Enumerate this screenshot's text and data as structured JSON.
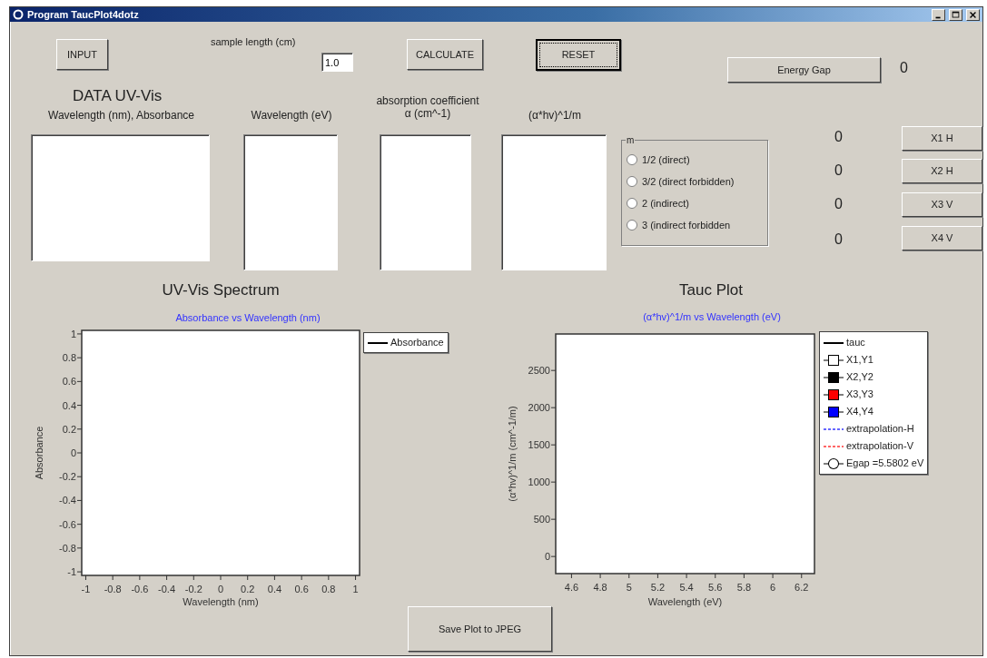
{
  "window": {
    "title": "Program TaucPlot4dotz"
  },
  "buttons": [
    {
      "label": "INPUT",
      "focused": false
    },
    {
      "label": "CALCULATE",
      "focused": false
    },
    {
      "label": "RESET",
      "focused": true
    }
  ],
  "sample_length": {
    "label": "sample length (cm)",
    "value": "1.0"
  },
  "energy_gap": {
    "button": "Energy Gap",
    "value": "0"
  },
  "data_section": {
    "title": "DATA UV-Vis",
    "columns": [
      {
        "header": "Wavelength (nm), Absorbance"
      },
      {
        "header": "Wavelength (eV)"
      },
      {
        "header": "absorption coefficient\nα (cm^-1)"
      },
      {
        "header": "(α*hv)^1/m"
      }
    ]
  },
  "m_group": {
    "label": "m",
    "options": [
      {
        "label": "1/2 (direct)",
        "selected": false
      },
      {
        "label": "3/2 (direct forbidden)",
        "selected": false
      },
      {
        "label": "2 (indirect)",
        "selected": false
      },
      {
        "label": "3 (indirect forbidden",
        "selected": false
      }
    ]
  },
  "points": [
    {
      "value": "0",
      "button": "X1 H"
    },
    {
      "value": "0",
      "button": "X2 H"
    },
    {
      "value": "0",
      "button": "X3 V"
    },
    {
      "value": "0",
      "button": "X4 V"
    }
  ],
  "charts": [
    {
      "heading": "UV-Vis Spectrum",
      "legend": [
        {
          "label": "Absorbance",
          "color": "#000000",
          "kind": "line"
        }
      ],
      "chart_data": {
        "type": "line",
        "title": "Absorbance vs Wavelength (nm)",
        "xlabel": "Wavelength (nm)",
        "ylabel": "Absorbance",
        "xlim": [
          -1.03,
          1.03
        ],
        "ylim": [
          -1.03,
          1.03
        ],
        "xticks": [
          -1,
          -0.8,
          -0.6,
          -0.4,
          -0.2,
          0,
          0.2,
          0.4,
          0.6,
          0.8,
          1
        ],
        "yticks": [
          -1,
          -0.8,
          -0.6,
          -0.4,
          -0.2,
          0,
          0.2,
          0.4,
          0.6,
          0.8,
          1
        ]
      }
    },
    {
      "heading": "Tauc Plot",
      "legend": [
        {
          "label": "tauc",
          "color": "#000000",
          "kind": "line"
        },
        {
          "label": "X1,Y1",
          "color": "#ffffff",
          "kind": "square"
        },
        {
          "label": "X2,Y2",
          "color": "#000000",
          "kind": "square"
        },
        {
          "label": "X3,Y3",
          "color": "#ff0000",
          "kind": "square"
        },
        {
          "label": "X4,Y4",
          "color": "#0000ff",
          "kind": "square"
        },
        {
          "label": "extrapolation-H",
          "color": "#6666ff",
          "kind": "dotted"
        },
        {
          "label": "extrapolation-V",
          "color": "#ff6666",
          "kind": "dotted"
        },
        {
          "label": "Egap =5.5802 eV",
          "color": "#ffffff",
          "kind": "circle"
        }
      ],
      "chart_data": {
        "type": "line",
        "title": "(α*hv)^1/m vs Wavelength (eV)",
        "xlabel": "Wavelength (eV)",
        "ylabel": "(α*hv)^1/m (cm^-1/m)",
        "xlim": [
          4.49,
          6.29
        ],
        "ylim": [
          -230,
          2990
        ],
        "xticks": [
          4.6,
          4.8,
          5,
          5.2,
          5.4,
          5.6,
          5.8,
          6,
          6.2
        ],
        "yticks": [
          0,
          500,
          1000,
          1500,
          2000,
          2500
        ]
      }
    }
  ],
  "save_button": "Save Plot to JPEG"
}
